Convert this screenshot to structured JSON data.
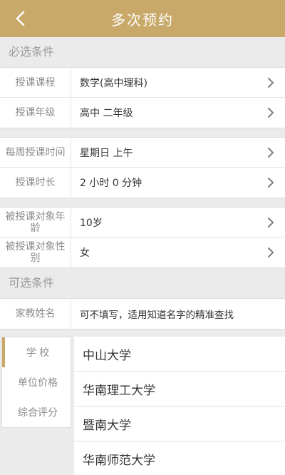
{
  "header": {
    "title": "多次预约"
  },
  "required": {
    "section_title": "必选条件",
    "group1": [
      {
        "label": "授课课程",
        "value": "数学(高中理科)"
      },
      {
        "label": "授课年级",
        "value": "高中 二年级"
      }
    ],
    "group2": [
      {
        "label": "每周授课时间",
        "value": "星期日 上午"
      },
      {
        "label": "授课时长",
        "value": "2 小时 0 分钟"
      }
    ],
    "group3": [
      {
        "label": "被授课对象年龄",
        "value": "10岁"
      },
      {
        "label": "被授课对象性别",
        "value": "女"
      }
    ]
  },
  "optional": {
    "section_title": "可选条件",
    "tutor_name": {
      "label": "家教姓名",
      "placeholder": "可不填写，适用知道名字的精准查找"
    }
  },
  "filter": {
    "tabs": [
      "学 校",
      "单位价格",
      "综合评分"
    ],
    "active_tab": "学 校",
    "schools": [
      "中山大学",
      "华南理工大学",
      "暨南大学",
      "华南师范大学"
    ]
  },
  "colors": {
    "header_bg": "#c9a96a",
    "accent": "#c9a96a"
  }
}
